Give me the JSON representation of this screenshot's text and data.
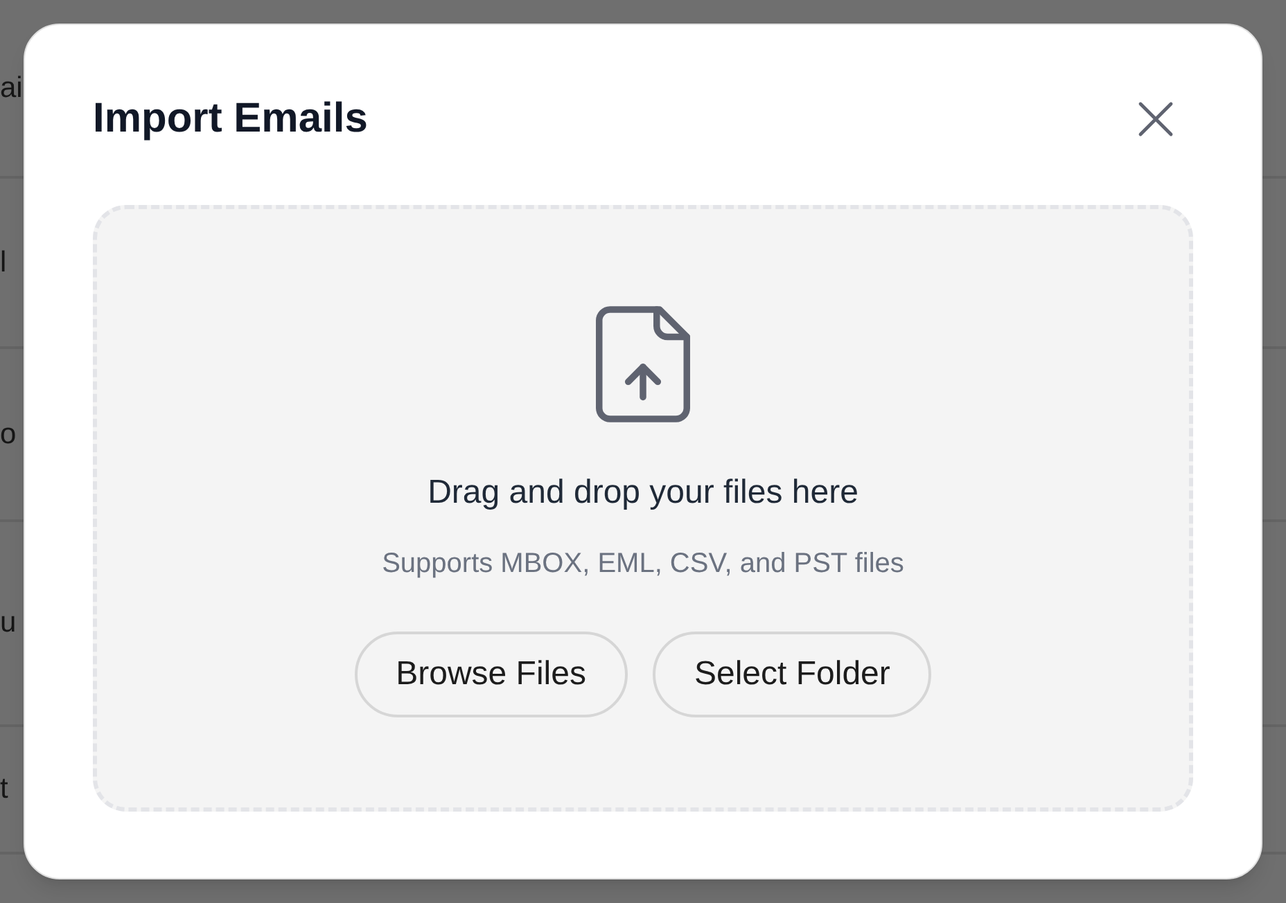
{
  "background_list": {
    "rows": [
      {
        "text": "ai"
      },
      {
        "text": "l"
      },
      {
        "text": "o"
      },
      {
        "text": "u"
      },
      {
        "text": "t"
      }
    ]
  },
  "dialog": {
    "title": "Import Emails",
    "dropzone": {
      "heading": "Drag and drop your files here",
      "hint": "Supports MBOX, EML, CSV, and PST files",
      "buttons": [
        {
          "label": "Browse Files"
        },
        {
          "label": "Select Folder"
        }
      ]
    }
  }
}
